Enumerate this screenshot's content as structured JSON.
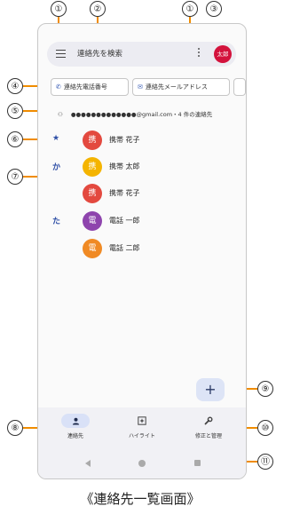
{
  "colors": {
    "accent": "#f08c00",
    "primary": "#2f4fa6"
  },
  "search": {
    "placeholder": "連絡先を検索"
  },
  "profile": {
    "avatar_text": "太郎",
    "color": "#d3123c"
  },
  "chips": [
    {
      "icon": "phone-icon",
      "label": "連絡先電話番号"
    },
    {
      "icon": "mail-icon",
      "label": "連絡先メールアドレス"
    }
  ],
  "account": {
    "text": "●●●●●●●●●●●●●@gmail.com・4 件の連絡先"
  },
  "contacts": [
    {
      "letter": "★",
      "avatar": "携",
      "color": "#e3493f",
      "name": "携帯 花子"
    },
    {
      "letter": "か",
      "avatar": "携",
      "color": "#f4b400",
      "name": "携帯 太郎"
    },
    {
      "letter": "",
      "avatar": "携",
      "color": "#e3493f",
      "name": "携帯 花子"
    },
    {
      "letter": "た",
      "avatar": "電",
      "color": "#8e44ad",
      "name": "電話 一郎"
    },
    {
      "letter": "",
      "avatar": "電",
      "color": "#f08a24",
      "name": "電話 二郎"
    }
  ],
  "fab": {
    "label": "+"
  },
  "nav": [
    {
      "icon": "person-icon",
      "label": "連絡先"
    },
    {
      "icon": "highlight-icon",
      "label": "ハイライト"
    },
    {
      "icon": "wrench-icon",
      "label": "修正と管理"
    }
  ],
  "callouts": [
    "①",
    "②",
    "①",
    "③",
    "④",
    "⑤",
    "⑥",
    "⑦",
    "⑧",
    "⑨",
    "⑩",
    "⑪"
  ],
  "caption": "《連絡先一覧画面》"
}
